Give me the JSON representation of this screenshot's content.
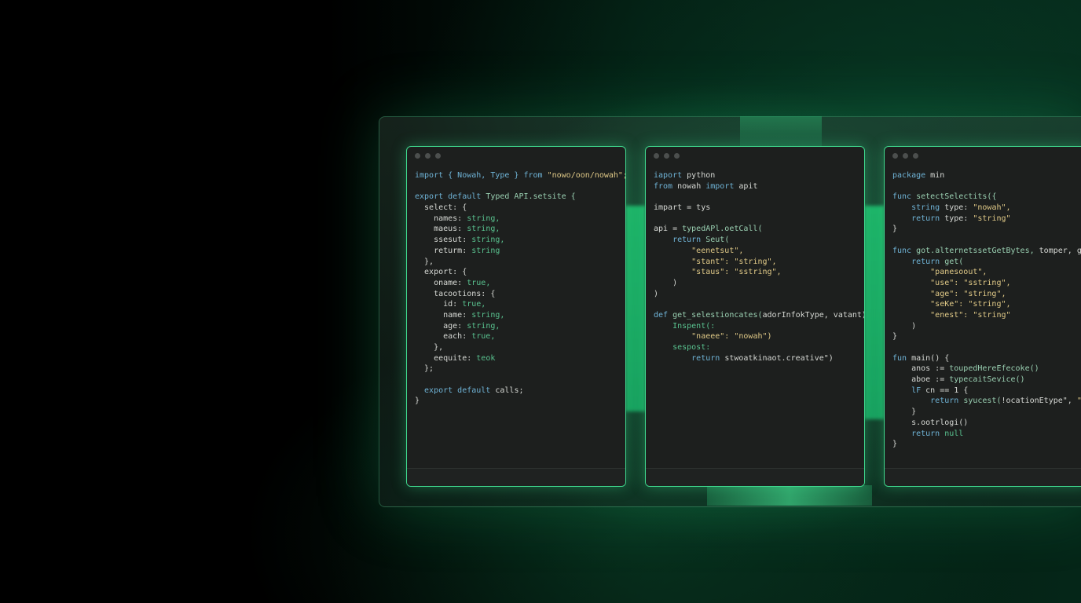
{
  "windows": [
    {
      "lines": [
        [
          [
            "import { Nowah, Type } ",
            "kw"
          ],
          [
            "from ",
            "kw"
          ],
          [
            "\"nowo/oon/nowah\";",
            "str"
          ]
        ],
        [],
        [
          [
            "export default ",
            "kw"
          ],
          [
            "Typed API.setsite {",
            "fn"
          ]
        ],
        [
          [
            "  select: {",
            ""
          ]
        ],
        [
          [
            "    names: ",
            ""
          ],
          [
            "string,",
            "ty"
          ]
        ],
        [
          [
            "    maeus: ",
            ""
          ],
          [
            "string,",
            "ty"
          ]
        ],
        [
          [
            "    ssesut: ",
            ""
          ],
          [
            "string,",
            "ty"
          ]
        ],
        [
          [
            "    returm: ",
            ""
          ],
          [
            "string",
            "ty"
          ]
        ],
        [
          [
            "  },",
            ""
          ]
        ],
        [
          [
            "  export: {",
            ""
          ]
        ],
        [
          [
            "    oname: ",
            ""
          ],
          [
            "true,",
            "ty"
          ]
        ],
        [
          [
            "    tacootions: {",
            ""
          ]
        ],
        [
          [
            "      id: ",
            ""
          ],
          [
            "true,",
            "ty"
          ]
        ],
        [
          [
            "      name: ",
            ""
          ],
          [
            "string,",
            "ty"
          ]
        ],
        [
          [
            "      age: ",
            ""
          ],
          [
            "string,",
            "ty"
          ]
        ],
        [
          [
            "      each: ",
            ""
          ],
          [
            "true,",
            "ty"
          ]
        ],
        [
          [
            "    },",
            ""
          ]
        ],
        [
          [
            "    eequite: ",
            ""
          ],
          [
            "teok",
            "ty"
          ]
        ],
        [
          [
            "  };",
            ""
          ]
        ],
        [],
        [
          [
            "  export default ",
            "kw"
          ],
          [
            "calls;",
            ""
          ]
        ],
        [
          [
            "}",
            ""
          ]
        ]
      ]
    },
    {
      "lines": [
        [
          [
            "iaport ",
            "kw"
          ],
          [
            "python",
            ""
          ]
        ],
        [
          [
            "from ",
            "kw"
          ],
          [
            "nowah ",
            ""
          ],
          [
            "import ",
            "kw"
          ],
          [
            "apit",
            ""
          ]
        ],
        [],
        [
          [
            "impart = tys",
            ""
          ]
        ],
        [],
        [
          [
            "api = ",
            ""
          ],
          [
            "typedAPl.oetCall(",
            "fn"
          ]
        ],
        [
          [
            "    return ",
            "kw"
          ],
          [
            "Seut(",
            "fn"
          ]
        ],
        [
          [
            "        \"eenetsut\",",
            "str"
          ]
        ],
        [
          [
            "        \"stant\": ",
            "str"
          ],
          [
            "\"string\",",
            "str"
          ]
        ],
        [
          [
            "        \"staus\": ",
            "str"
          ],
          [
            "\"sstring\",",
            "str"
          ]
        ],
        [
          [
            "    )",
            ""
          ]
        ],
        [
          [
            ")",
            ""
          ]
        ],
        [],
        [
          [
            "def ",
            "kw"
          ],
          [
            "get_selestioncates(",
            "fn"
          ],
          [
            "adorInfokType, vatant):",
            ""
          ]
        ],
        [
          [
            "    Inspent(:",
            "ty"
          ]
        ],
        [
          [
            "        \"naeee\": ",
            "str"
          ],
          [
            "\"nowah\")",
            "str"
          ]
        ],
        [
          [
            "    sespost:",
            "ty"
          ]
        ],
        [
          [
            "        return ",
            "kw"
          ],
          [
            "stwoatkinaot.creative\")",
            ""
          ]
        ]
      ]
    },
    {
      "lines": [
        [
          [
            "package ",
            "kw"
          ],
          [
            "min",
            ""
          ]
        ],
        [],
        [
          [
            "func ",
            "kw"
          ],
          [
            "setectSelectits({",
            "fn"
          ]
        ],
        [
          [
            "    string ",
            "kw"
          ],
          [
            "type: ",
            ""
          ],
          [
            "\"nowah\",",
            "str"
          ]
        ],
        [
          [
            "    return ",
            "kw"
          ],
          [
            "type: ",
            ""
          ],
          [
            "\"string\"",
            "str"
          ]
        ],
        [
          [
            "}",
            ""
          ]
        ],
        [],
        [
          [
            "func ",
            "kw"
          ],
          [
            "got.alternetssetGetBytes, ",
            "fn"
          ],
          [
            "tomper, go {",
            ""
          ]
        ],
        [
          [
            "    return ",
            "kw"
          ],
          [
            "get(",
            "fn"
          ]
        ],
        [
          [
            "        \"panesoout\",",
            "str"
          ]
        ],
        [
          [
            "        \"use\": ",
            "str"
          ],
          [
            "\"sstring\",",
            "str"
          ]
        ],
        [
          [
            "        \"age\": ",
            "str"
          ],
          [
            "\"string\",",
            "str"
          ]
        ],
        [
          [
            "        \"seKe\": ",
            "str"
          ],
          [
            "\"string\",",
            "str"
          ]
        ],
        [
          [
            "        \"enest\": ",
            "str"
          ],
          [
            "\"string\"",
            "str"
          ]
        ],
        [
          [
            "    )",
            ""
          ]
        ],
        [
          [
            "}",
            ""
          ]
        ],
        [],
        [
          [
            "fun ",
            "kw"
          ],
          [
            "main() {",
            ""
          ]
        ],
        [
          [
            "    anos := ",
            ""
          ],
          [
            "toupedHereEfecoke()",
            "fn"
          ]
        ],
        [
          [
            "    aboe := ",
            ""
          ],
          [
            "typecaitSevice()",
            "fn"
          ]
        ],
        [
          [
            "    lF ",
            "kw"
          ],
          [
            "cn == 1 {",
            ""
          ]
        ],
        [
          [
            "        return ",
            "kw"
          ],
          [
            "syucest(",
            "fn"
          ],
          [
            "!ocationEtype\", ",
            ""
          ],
          [
            "\"nes",
            "str"
          ]
        ],
        [
          [
            "    }",
            ""
          ]
        ],
        [
          [
            "    s.ootrlogi()",
            ""
          ]
        ],
        [
          [
            "    return ",
            "kw"
          ],
          [
            "null",
            "ty"
          ]
        ],
        [
          [
            "}",
            ""
          ]
        ]
      ]
    }
  ]
}
